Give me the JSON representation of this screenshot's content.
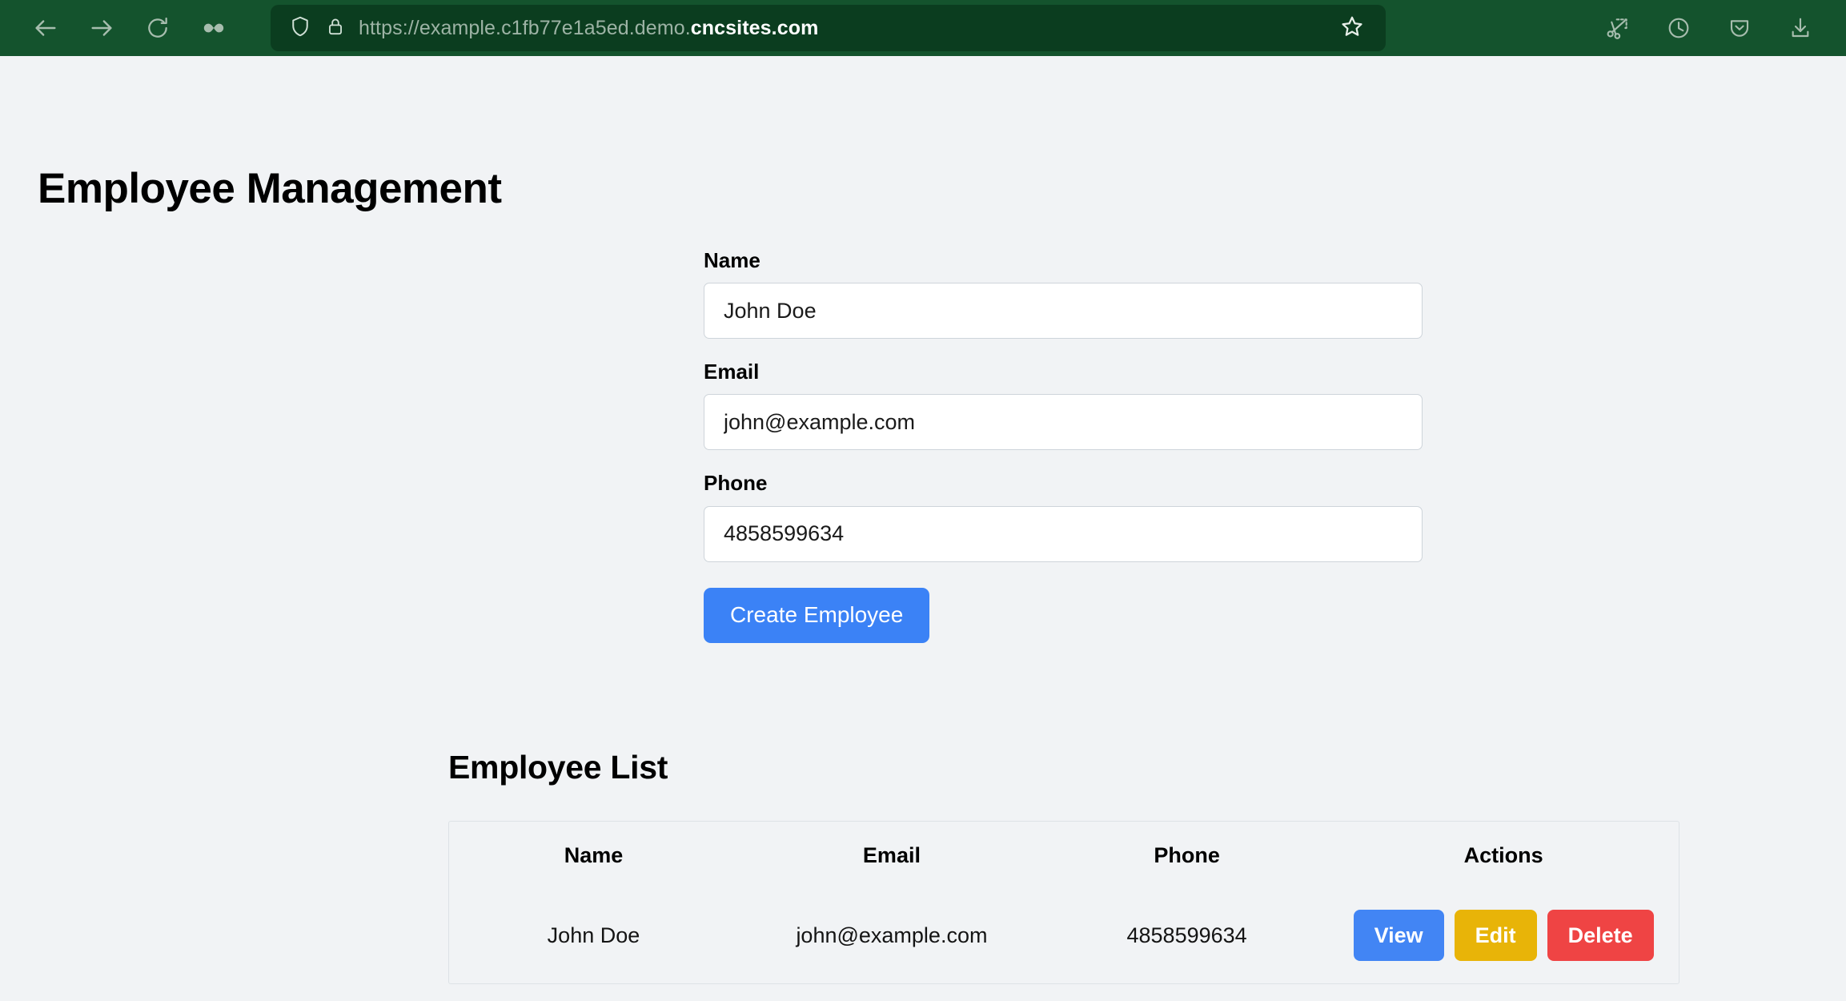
{
  "browser": {
    "nav": {
      "back_icon": "back-arrow-icon",
      "forward_icon": "forward-arrow-icon",
      "reload_icon": "reload-icon",
      "extension_icon": "infinity-extension-icon"
    },
    "urlbar": {
      "shield_icon": "shield-icon",
      "lock_icon": "padlock-icon",
      "url_prefix": "https://example.c1fb77e1a5ed.demo.",
      "url_domain": "cncsites.com",
      "bookmark_icon": "star-bookmark-icon"
    },
    "right_icons": [
      {
        "name": "screenshot-scissors-icon"
      },
      {
        "name": "history-clock-icon"
      },
      {
        "name": "pocket-icon"
      },
      {
        "name": "downloads-icon"
      }
    ],
    "colors": {
      "toolbar_bg": "#14532d",
      "urlbar_bg": "#0b3d1f",
      "icon": "#a7bdae",
      "url_prefix_color": "#9db3a5",
      "url_domain_color": "#ffffff"
    }
  },
  "page": {
    "title": "Employee Management",
    "background": "#f1f3f5"
  },
  "form": {
    "fields": [
      {
        "label": "Name",
        "value": "John Doe",
        "placeholder": "Name"
      },
      {
        "label": "Email",
        "value": "john@example.com",
        "placeholder": "Email"
      },
      {
        "label": "Phone",
        "value": "4858599634",
        "placeholder": "Phone"
      }
    ],
    "submit_label": "Create Employee",
    "submit_color": "#3b82f6"
  },
  "list": {
    "title": "Employee List",
    "columns": [
      "Name",
      "Email",
      "Phone",
      "Actions"
    ],
    "rows": [
      {
        "name": "John Doe",
        "email": "john@example.com",
        "phone": "4858599634",
        "actions": [
          {
            "label": "View",
            "color": "#4285f4"
          },
          {
            "label": "Edit",
            "color": "#e8b408"
          },
          {
            "label": "Delete",
            "color": "#ef4444"
          }
        ]
      }
    ]
  }
}
